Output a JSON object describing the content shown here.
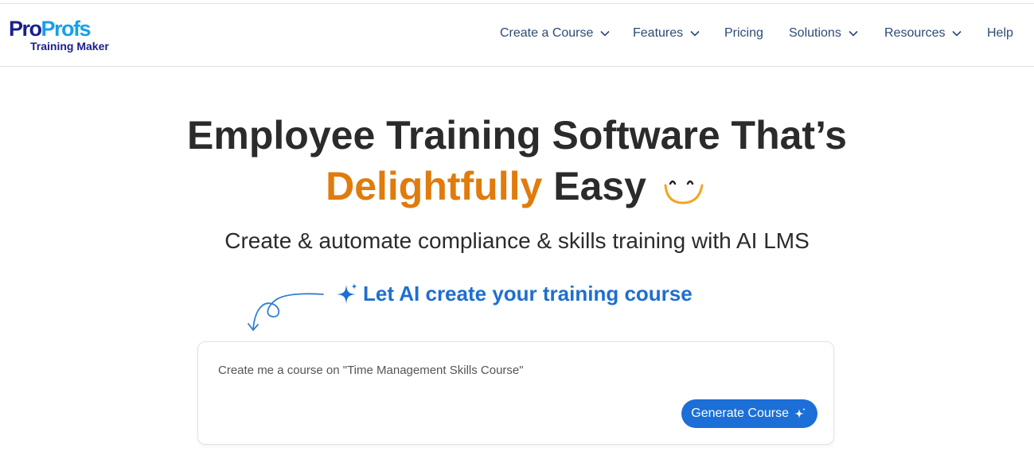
{
  "brand": {
    "logo_part1": "Pro",
    "logo_part2": "Profs",
    "logo_sub": "Training Maker",
    "colors": {
      "navy": "#1b1e8c",
      "sky": "#17a0e6"
    }
  },
  "nav": {
    "items": [
      {
        "label": "Create a Course",
        "has_dropdown": true
      },
      {
        "label": "Features",
        "has_dropdown": true
      },
      {
        "label": "Pricing",
        "has_dropdown": false
      },
      {
        "label": "Solutions",
        "has_dropdown": true
      },
      {
        "label": "Resources",
        "has_dropdown": true
      },
      {
        "label": "Help",
        "has_dropdown": false
      }
    ],
    "icons": {
      "dropdown": "chevron-down-icon"
    }
  },
  "hero": {
    "title_line1": "Employee Training Software That’s",
    "title_highlight": "Delightfully",
    "title_rest": "Easy",
    "subtitle": "Create & automate compliance & skills training with AI LMS",
    "accent_color": "#e07b0c",
    "smile_icon": "smile-icon"
  },
  "ai": {
    "cta_label": "Let AI create your training course",
    "cta_color": "#1e6fd0",
    "sparkle_icon": "sparkle-icon",
    "arrow_icon": "curly-arrow-icon",
    "prompt_text": "Create me a course on \"Time Management Skills Course\"",
    "generate_label": "Generate Course",
    "button_color": "#1b6fd6"
  }
}
